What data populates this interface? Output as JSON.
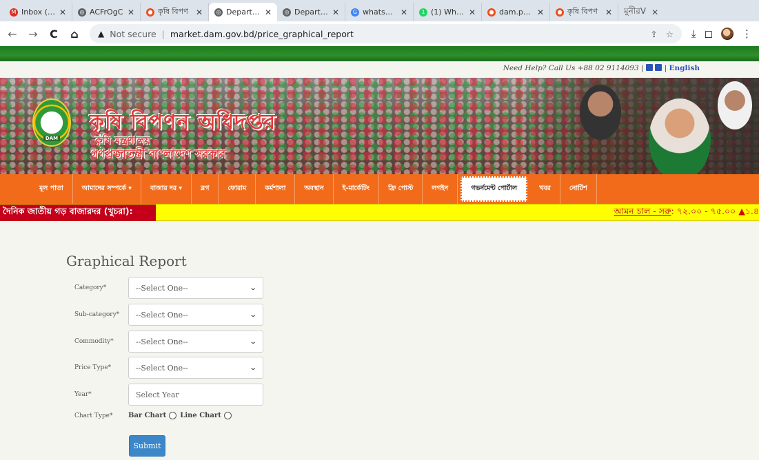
{
  "browser": {
    "tabs": [
      {
        "label": "Inbox (24",
        "color": "#d93025",
        "glyph": "M"
      },
      {
        "label": "ACFrOgC",
        "color": "#5f6368",
        "glyph": "◎"
      },
      {
        "label": "কৃষি বিপণ",
        "color": "#e8501e",
        "glyph": "●"
      },
      {
        "label": "Departme",
        "color": "#5f6368",
        "glyph": "◎",
        "active": true
      },
      {
        "label": "Departme",
        "color": "#5f6368",
        "glyph": "◎"
      },
      {
        "label": "whatsapp",
        "color": "#4285f4",
        "glyph": "G"
      },
      {
        "label": "(1) Whats",
        "color": "#25d366",
        "glyph": "1"
      },
      {
        "label": "dam.port",
        "color": "#e8501e",
        "glyph": "●"
      },
      {
        "label": "কৃষি বিপণ",
        "color": "#e8501e",
        "glyph": "●"
      }
    ],
    "tab_extra": "মুনীরV",
    "url_security": "Not secure",
    "url": "market.dam.gov.bd/price_graphical_report"
  },
  "header": {
    "help_text": "Need Help? Call Us +88 02 9114093",
    "language": "English"
  },
  "banner": {
    "logo_text": "DAM",
    "title": "কৃষি বিপণন অধিদপ্তর",
    "subtitle": "কৃষি মন্ত্রণালয়",
    "gov": "গণপ্রজাতন্ত্রী বাংলাদেশ সরকার"
  },
  "nav": {
    "items": [
      {
        "label": "মূল পাতা"
      },
      {
        "label": "আমাদের সম্পর্কে ▾"
      },
      {
        "label": "বাজার দর ▾"
      },
      {
        "label": "ব্লগ"
      },
      {
        "label": "ফোরাম"
      },
      {
        "label": "কর্মশালা"
      },
      {
        "label": "অবস্থান"
      },
      {
        "label": "ই-মার্কেটিং"
      },
      {
        "label": "ফ্রি পোস্ট"
      },
      {
        "label": "লগইন"
      },
      {
        "label": "গভর্নমেন্ট পোর্টাল",
        "highlight": true
      },
      {
        "label": "খবর"
      },
      {
        "label": "নোটিশ"
      }
    ]
  },
  "ticker": {
    "label": "দৈনিক জাতীয় গড় বাজারদর (খুচরা):",
    "item": "আমন চাল - সরু",
    "price": ": ৭২.০০ - ৭৫.০০",
    "change": "▲১.৪"
  },
  "form": {
    "title": "Graphical Report",
    "category": {
      "label": "Category*",
      "value": "--Select One--"
    },
    "subcategory": {
      "label": "Sub-category*",
      "value": "--Select One--"
    },
    "commodity": {
      "label": "Commodity*",
      "value": "--Select One--"
    },
    "price_type": {
      "label": "Price Type*",
      "value": "--Select One--"
    },
    "year": {
      "label": "Year*",
      "placeholder": "Select Year"
    },
    "chart_type": {
      "label": "Chart Type*",
      "option1": "Bar Chart",
      "option2": "Line Chart"
    },
    "submit": "Submit"
  }
}
